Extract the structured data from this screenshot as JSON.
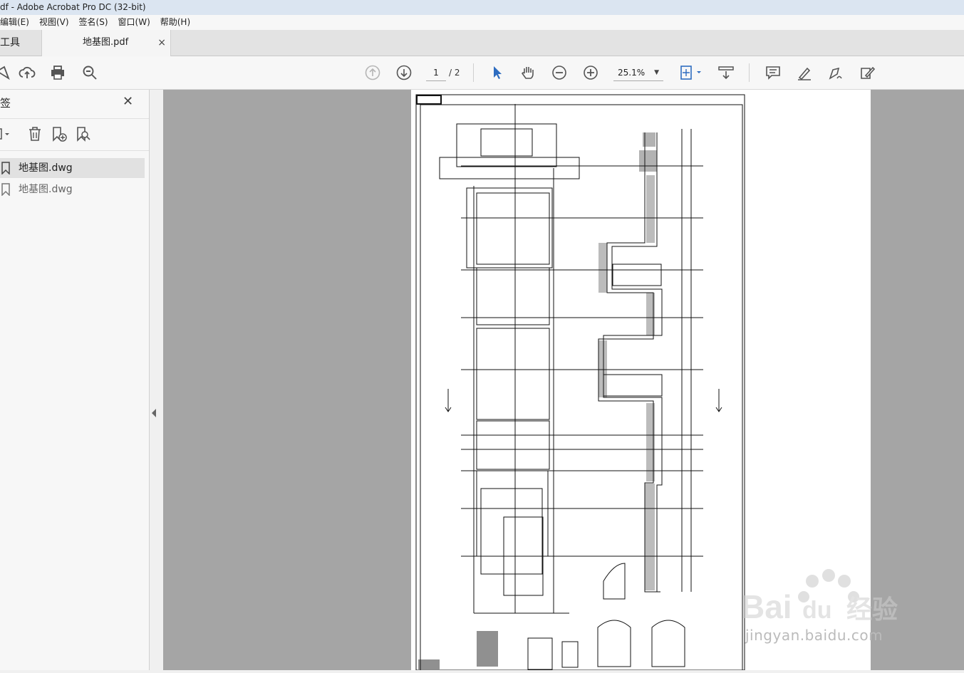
{
  "window": {
    "title": "df - Adobe Acrobat Pro DC (32-bit)"
  },
  "menu": [
    {
      "label": "编辑(E)"
    },
    {
      "label": "视图(V)"
    },
    {
      "label": "签名(S)"
    },
    {
      "label": "窗口(W)"
    },
    {
      "label": "帮助(H)"
    }
  ],
  "tabs": {
    "tools": "工具",
    "document": "地基图.pdf",
    "close": "×"
  },
  "toolbar": {
    "page_current": "1",
    "page_total": "/ 2",
    "zoom": "25.1%"
  },
  "sidebar": {
    "title": "签",
    "close": "✕",
    "bookmarks": [
      {
        "label": "地基图.dwg",
        "selected": true
      },
      {
        "label": "地基图.dwg",
        "selected": false
      }
    ]
  },
  "watermark": {
    "brand": "Bai 经验",
    "url": "jingyan.baidu.com"
  },
  "colors": {
    "accent": "#2d6cc0",
    "canvas": "#a5a5a5"
  }
}
